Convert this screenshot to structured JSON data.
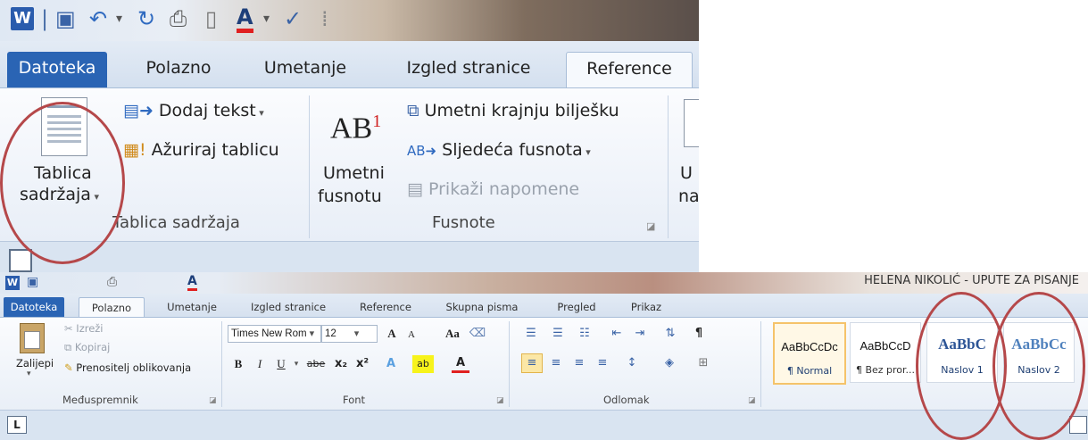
{
  "top": {
    "tabs": [
      "Datoteka",
      "Polazno",
      "Umetanje",
      "Izgled stranice",
      "Reference"
    ],
    "groups": {
      "toc": {
        "big_button_line1": "Tablica",
        "big_button_line2": "sadržaja",
        "add_text": "Dodaj tekst",
        "update_table": "Ažuriraj tablicu",
        "label": "Tablica sadržaja"
      },
      "footnotes": {
        "big_icon_text": "AB",
        "big_icon_sup": "1",
        "big_button_line1": "Umetni",
        "big_button_line2": "fusnotu",
        "insert_endnote": "Umetni krajnju bilješku",
        "next_footnote": "Sljedeća fusnota",
        "show_notes": "Prikaži napomene",
        "label": "Fusnote"
      },
      "partial": {
        "line1": "U",
        "line2": "na"
      }
    }
  },
  "bottom": {
    "window_title": "HELENA NIKOLIĆ - UPUTE ZA PISANJE",
    "tabs": [
      "Datoteka",
      "Polazno",
      "Umetanje",
      "Izgled stranice",
      "Reference",
      "Skupna pisma",
      "Pregled",
      "Prikaz"
    ],
    "clipboard": {
      "paste": "Zalijepi",
      "cut": "Izreži",
      "copy": "Kopiraj",
      "format_painter": "Prenositelj oblikovanja",
      "label": "Međuspremnik"
    },
    "font": {
      "font_name": "Times New Rom",
      "font_size": "12",
      "bold": "B",
      "italic": "I",
      "underline": "U",
      "strikethrough": "abe",
      "subscript": "x₂",
      "superscript": "x²",
      "grow": "A",
      "shrink": "A",
      "change_case": "Aa",
      "highlight": "ab",
      "font_color": "A",
      "clear": "A",
      "label": "Font"
    },
    "paragraph": {
      "label": "Odlomak"
    },
    "styles": [
      {
        "sample": "AaBbCcDc",
        "name": "¶ Normal"
      },
      {
        "sample": "AaBbCcD",
        "name": "¶ Bez pror..."
      },
      {
        "sample": "AaBbC",
        "name": "Naslov 1"
      },
      {
        "sample": "AaBbCc",
        "name": "Naslov 2"
      }
    ],
    "ruler_corner": "L"
  },
  "colors": {
    "file_tab": "#2a64b4",
    "annotation_ring": "#b5484a",
    "heading_blue": "#1f3f73",
    "selected_style": "#f5c36a"
  }
}
